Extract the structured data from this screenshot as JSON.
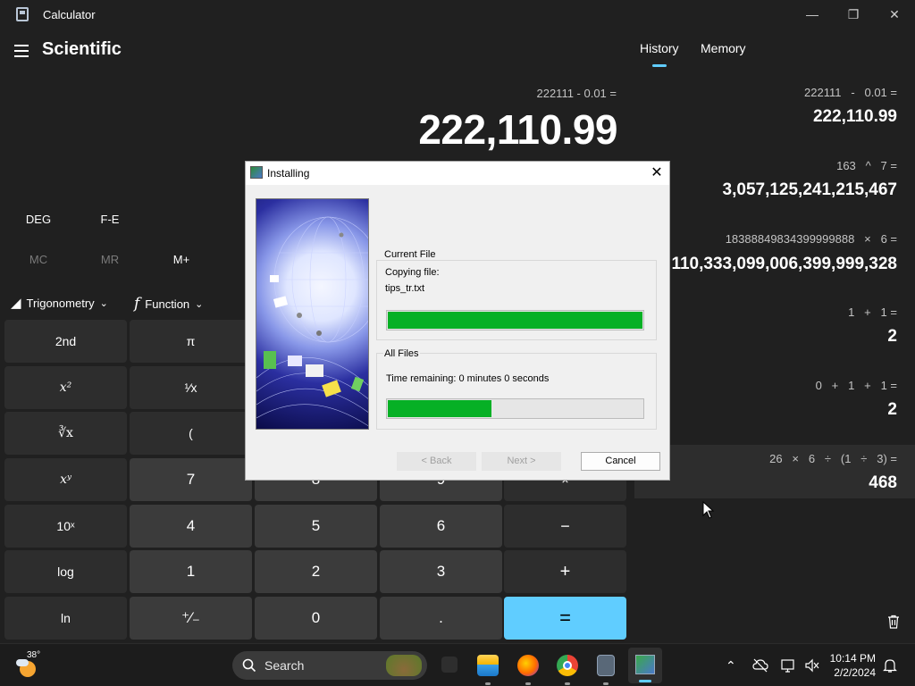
{
  "window": {
    "title": "Calculator"
  },
  "header": {
    "mode": "Scientific",
    "tabs": [
      {
        "label": "History",
        "active": true
      },
      {
        "label": "Memory",
        "active": false
      }
    ]
  },
  "display": {
    "expression": "222111 - 0.01 =",
    "result": "222,110.99"
  },
  "mode_row": {
    "angle": "DEG",
    "fe": "F-E"
  },
  "memory_row": {
    "mc": "MC",
    "mr": "MR",
    "mplus": "M+"
  },
  "dropdowns": {
    "trig": "Trigonometry",
    "func": "Function"
  },
  "keys": {
    "second": "2nd",
    "pi": "π",
    "x2": "x²",
    "recip": "¹⁄x",
    "cuberoot": "∛x",
    "lparen": "(",
    "xy": "xʸ",
    "seven": "7",
    "eight": "8",
    "nine": "9",
    "mult": "×",
    "tenx": "10ˣ",
    "four": "4",
    "five": "5",
    "six": "6",
    "minus": "−",
    "log": "log",
    "one": "1",
    "two": "2",
    "three": "3",
    "plus": "+",
    "ln": "ln",
    "negate": "⁺⁄₋",
    "zero": "0",
    "decimal": ".",
    "equals": "="
  },
  "history": [
    {
      "expr": "222111   -   0.01 =",
      "result": "222,110.99"
    },
    {
      "expr": "163   ^   7 =",
      "result": "3,057,125,241,215,467"
    },
    {
      "expr": "18388849834399999888   ×   6 =",
      "result": "110,333,099,006,399,999,328"
    },
    {
      "expr": "1   +   1 =",
      "result": "2"
    },
    {
      "expr": "0   +   1   +   1 =",
      "result": "2"
    },
    {
      "expr": "26   ×   6   ÷   (1   ÷   3) =",
      "result": "468"
    }
  ],
  "dialog": {
    "title": "Installing",
    "current_file_label": "Current File",
    "copying_label": "Copying file:",
    "file_name": "tips_tr.txt",
    "current_progress": 1.0,
    "all_files_label": "All Files",
    "time_remaining": "Time remaining: 0 minutes 0 seconds",
    "all_progress": 0.41,
    "back": "< Back",
    "next": "Next >",
    "cancel": "Cancel"
  },
  "taskbar": {
    "weather": "38°",
    "search_placeholder": "Search",
    "time": "10:14 PM",
    "date": "2/2/2024"
  },
  "colors": {
    "accent": "#60cdff",
    "progress": "#06b025",
    "background": "#202020"
  }
}
